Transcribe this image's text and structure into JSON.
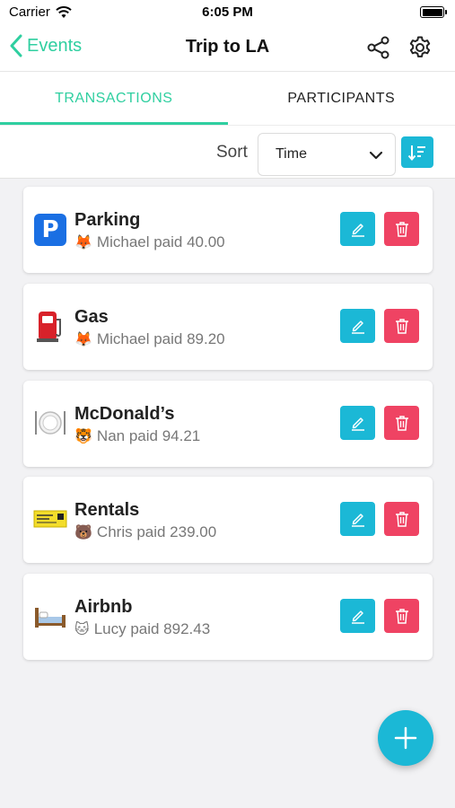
{
  "status_bar": {
    "carrier": "Carrier",
    "time": "6:05 PM"
  },
  "nav": {
    "back_label": "Events",
    "title": "Trip to LA"
  },
  "tabs": [
    {
      "label": "TRANSACTIONS",
      "active": true
    },
    {
      "label": "PARTICIPANTS",
      "active": false
    }
  ],
  "sort": {
    "label": "Sort",
    "selected": "Time"
  },
  "transactions": [
    {
      "title": "Parking",
      "icon": "parking-sign-icon",
      "payer_emoji": "🦊",
      "subtitle": "Michael paid 40.00"
    },
    {
      "title": "Gas",
      "icon": "fuel-pump-icon",
      "payer_emoji": "🦊",
      "subtitle": "Michael paid 89.20"
    },
    {
      "title": "McDonald’s",
      "icon": "plate-cutlery-icon",
      "payer_emoji": "🐯",
      "subtitle": "Nan paid 94.21"
    },
    {
      "title": "Rentals",
      "icon": "ticket-icon",
      "payer_emoji": "🐻",
      "subtitle": "Chris paid 239.00"
    },
    {
      "title": "Airbnb",
      "icon": "bed-icon",
      "payer_emoji": "🐱",
      "subtitle": "Lucy paid 892.43"
    }
  ],
  "colors": {
    "accent_green": "#2fcfa0",
    "edit_blue": "#1bb8d6",
    "delete_red": "#ef4363"
  }
}
